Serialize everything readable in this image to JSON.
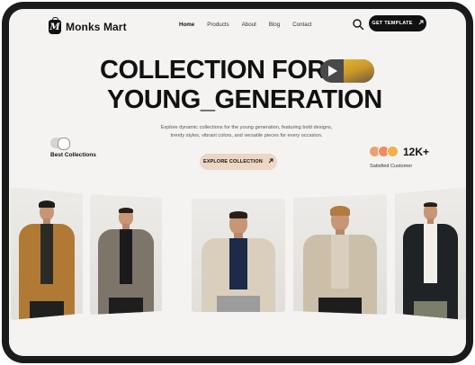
{
  "brand": {
    "name": "Monks Mart",
    "logo_letter": "M"
  },
  "nav": {
    "items": [
      {
        "label": "Home",
        "active": true
      },
      {
        "label": "Products",
        "active": false
      },
      {
        "label": "About",
        "active": false
      },
      {
        "label": "Blog",
        "active": false
      },
      {
        "label": "Contact",
        "active": false
      }
    ],
    "search_icon": "search-icon",
    "cta_label": "GET TEMPLATE",
    "cta_icon": "arrow-up-right-icon"
  },
  "hero": {
    "title_line1": "COLLECTION FOR",
    "title_line2": "YOUNG_GENERATION",
    "description_line1": "Explore dynamic collections for the young generation, featuring bold designs,",
    "description_line2": "trendy styles, vibrant colors, and versatile pieces for every occasion.",
    "video_icon": "play-icon",
    "best_collections_label": "Best Collections",
    "explore_label": "EXPLORE COLLECTION",
    "stat_value": "12K+",
    "stat_label": "Satisfied Customer"
  },
  "colors": {
    "background": "#f4f3f1",
    "primary": "#111111",
    "accent": "#ecd6c4"
  },
  "products": [
    {
      "name": "mustard-jacket-model",
      "jacket_color": "#b07a34"
    },
    {
      "name": "plaid-coat-model",
      "jacket_color": "#7d746a"
    },
    {
      "name": "fleece-vest-model",
      "jacket_color": "#d9cfbc"
    },
    {
      "name": "beige-fleece-model",
      "jacket_color": "#cbbfa9"
    },
    {
      "name": "black-jacket-model",
      "jacket_color": "#1f2326"
    }
  ]
}
